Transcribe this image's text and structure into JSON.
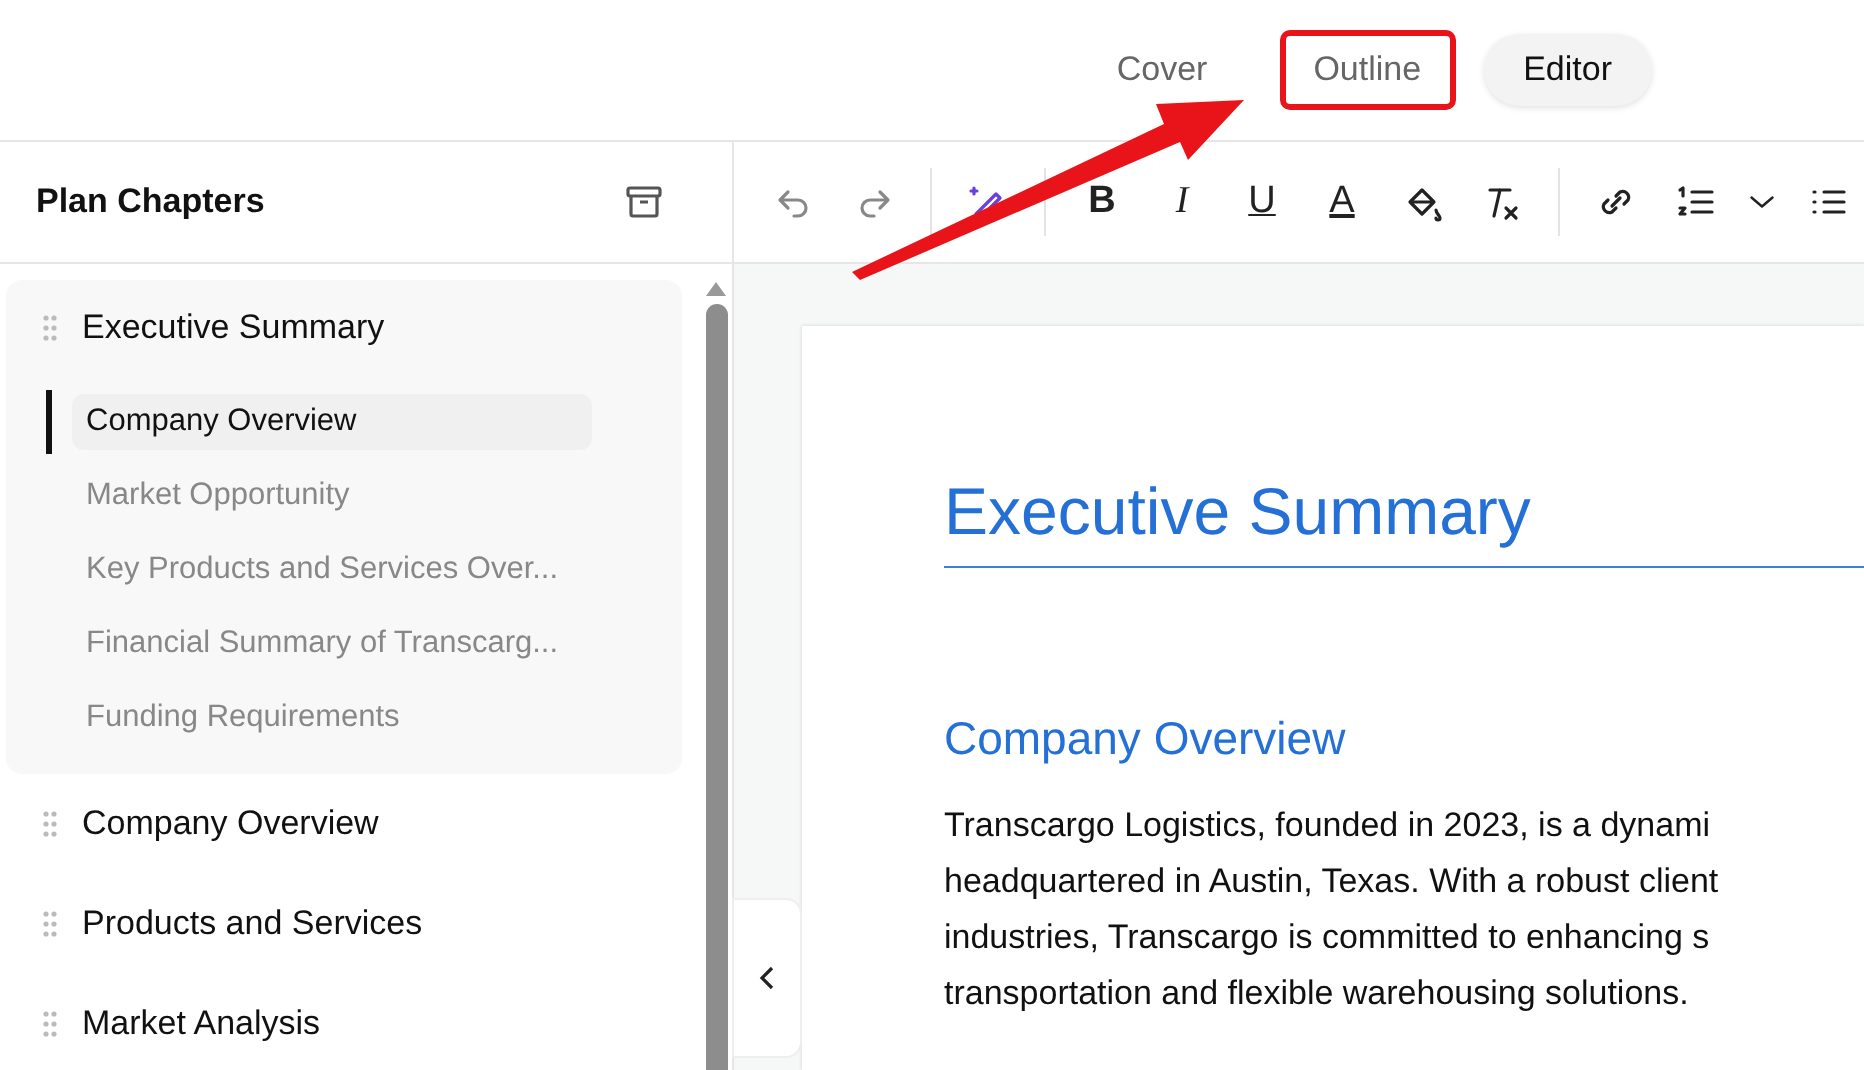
{
  "tabs": [
    {
      "label": "Cover",
      "selected": false,
      "highlighted": false
    },
    {
      "label": "Outline",
      "selected": false,
      "highlighted": true
    },
    {
      "label": "Editor",
      "selected": true,
      "highlighted": false
    }
  ],
  "sidebar": {
    "title": "Plan Chapters",
    "chapters": [
      {
        "label": "Executive Summary",
        "expanded": true,
        "children": [
          {
            "label": "Company Overview",
            "selected": true
          },
          {
            "label": "Market Opportunity",
            "selected": false
          },
          {
            "label": "Key Products and Services Over...",
            "selected": false
          },
          {
            "label": "Financial Summary of Transcarg...",
            "selected": false
          },
          {
            "label": "Funding Requirements",
            "selected": false
          }
        ]
      },
      {
        "label": "Company Overview",
        "expanded": false
      },
      {
        "label": "Products and Services",
        "expanded": false
      },
      {
        "label": "Market Analysis",
        "expanded": false
      }
    ]
  },
  "toolbar": [
    {
      "kind": "undo",
      "disabled": true
    },
    {
      "kind": "redo",
      "disabled": true
    },
    {
      "kind": "sep"
    },
    {
      "kind": "wand",
      "disabled": false
    },
    {
      "kind": "sep"
    },
    {
      "kind": "bold",
      "label": "B",
      "disabled": false
    },
    {
      "kind": "italic",
      "label": "I",
      "disabled": false
    },
    {
      "kind": "underline",
      "label": "U",
      "disabled": false
    },
    {
      "kind": "textcolor",
      "label": "A",
      "disabled": false
    },
    {
      "kind": "bucket",
      "disabled": false
    },
    {
      "kind": "clear",
      "disabled": false
    },
    {
      "kind": "sep"
    },
    {
      "kind": "link",
      "disabled": false
    },
    {
      "kind": "numbered",
      "disabled": false
    },
    {
      "kind": "chevron",
      "disabled": false
    },
    {
      "kind": "bullets",
      "disabled": false
    }
  ],
  "document": {
    "title": "Executive Summary",
    "heading": "Company Overview",
    "lines": [
      "Transcargo Logistics, founded in 2023, is a dynami",
      "headquartered in Austin, Texas. With a robust client",
      "industries, Transcargo is committed to enhancing s",
      "transportation and flexible warehousing solutions."
    ]
  }
}
